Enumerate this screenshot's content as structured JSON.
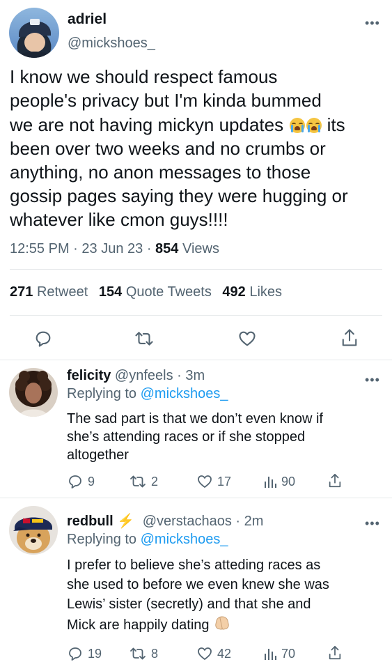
{
  "main_tweet": {
    "display_name": "adriel",
    "handle": "@mickshoes_",
    "text_line1": "I know we should respect famous",
    "text_line2": "people's privacy but I'm kinda bummed",
    "text_line3_before": "we are not having mickyn updates",
    "text_line3_after": " its",
    "text_line4": "been over two weeks and no crumbs or",
    "text_line5": "anything, no anon messages to those",
    "text_line6": "gossip pages saying they were hugging or",
    "text_line7": "whatever like cmon guys!!!!",
    "time": "12:55 PM",
    "date": "23 Jun 23",
    "views_count": "854",
    "views_label": "Views",
    "emoji_name": "loudly-crying-face"
  },
  "stats": {
    "retweets_count": "271",
    "retweets_label": "Retweet",
    "quotes_count": "154",
    "quotes_label": "Quote Tweets",
    "likes_count": "492",
    "likes_label": "Likes"
  },
  "icons": {
    "reply": "reply-icon",
    "retweet": "retweet-icon",
    "like": "like-icon",
    "share": "share-icon",
    "views": "views-icon",
    "more": "more-icon"
  },
  "replies": [
    {
      "display_name": "felicity",
      "handle": "@ynfeels",
      "time": "· 3m",
      "replying_to_label": "Replying to",
      "replying_to_handle": "@mickshoes_",
      "text_line1": "The sad part is that we don’t even know if",
      "text_line2": "she’s attending races or if she stopped",
      "text_line3": "altogether",
      "reply_count": "9",
      "retweet_count": "2",
      "like_count": "17",
      "views_count": "90"
    },
    {
      "display_name": "redbull",
      "handle": "@verstachaos",
      "time": "· 2m",
      "replying_to_label": "Replying to",
      "replying_to_handle": "@mickshoes_",
      "text_line1": "I prefer to believe she’s atteding races as",
      "text_line2": "she used to before we even knew she was",
      "text_line3": "Lewis’ sister (secretly) and that she and",
      "text_line4": "Mick are happily dating",
      "reply_count": "19",
      "retweet_count": "8",
      "like_count": "42",
      "views_count": "70",
      "emoji_name": "folded-hands"
    }
  ],
  "colors": {
    "accent": "#1d9bf0",
    "secondary_text": "#536471",
    "primary_text": "#0f1419",
    "divider": "#e6e9eb"
  }
}
